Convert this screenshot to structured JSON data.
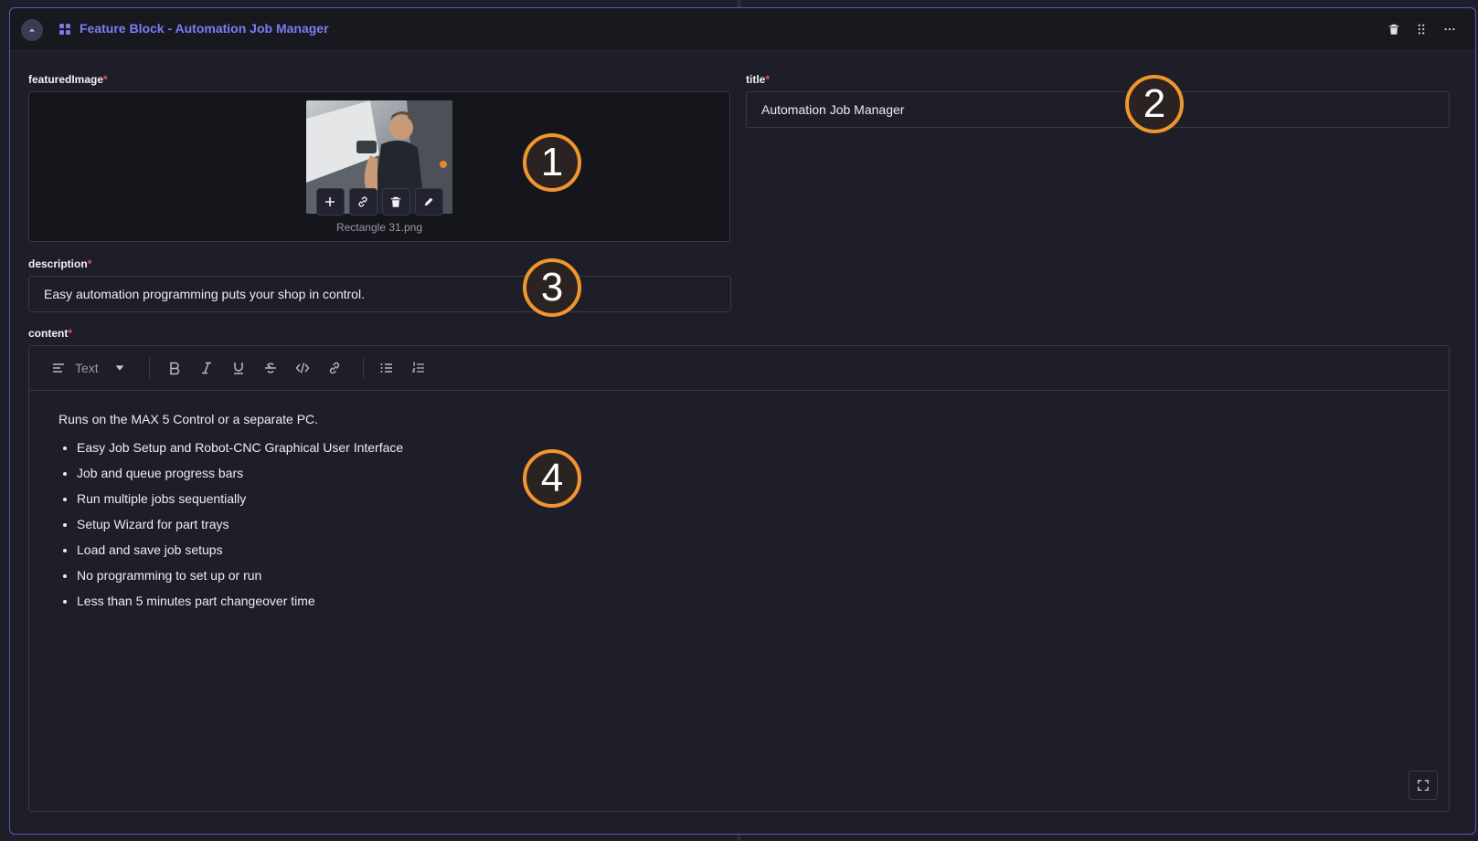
{
  "header": {
    "block_title": "Feature Block - Automation Job Manager"
  },
  "fields": {
    "featured_image": {
      "label": "featuredImage",
      "required_mark": "*",
      "file_name": "Rectangle 31.png"
    },
    "title": {
      "label": "title",
      "required_mark": "*",
      "value": "Automation Job Manager"
    },
    "description": {
      "label": "description",
      "required_mark": "*",
      "value": "Easy automation programming puts your shop in control."
    },
    "content": {
      "label": "content",
      "required_mark": "*",
      "toolbar": {
        "paragraph_style": "Text"
      },
      "intro": "Runs on the MAX 5 Control or a separate PC.",
      "bullets": [
        "Easy Job Setup and Robot-CNC Graphical User Interface",
        "Job and queue progress bars",
        "Run multiple jobs sequentially",
        "Setup Wizard for part trays",
        "Load and save job setups",
        "No programming to set up or run",
        "Less than 5 minutes part changeover time"
      ]
    }
  },
  "annotations": [
    "1",
    "2",
    "3",
    "4"
  ],
  "colors": {
    "accent": "#7b7bf0",
    "border": "#5b56c7",
    "required": "#e2574c",
    "badge_ring": "#f0962e"
  }
}
